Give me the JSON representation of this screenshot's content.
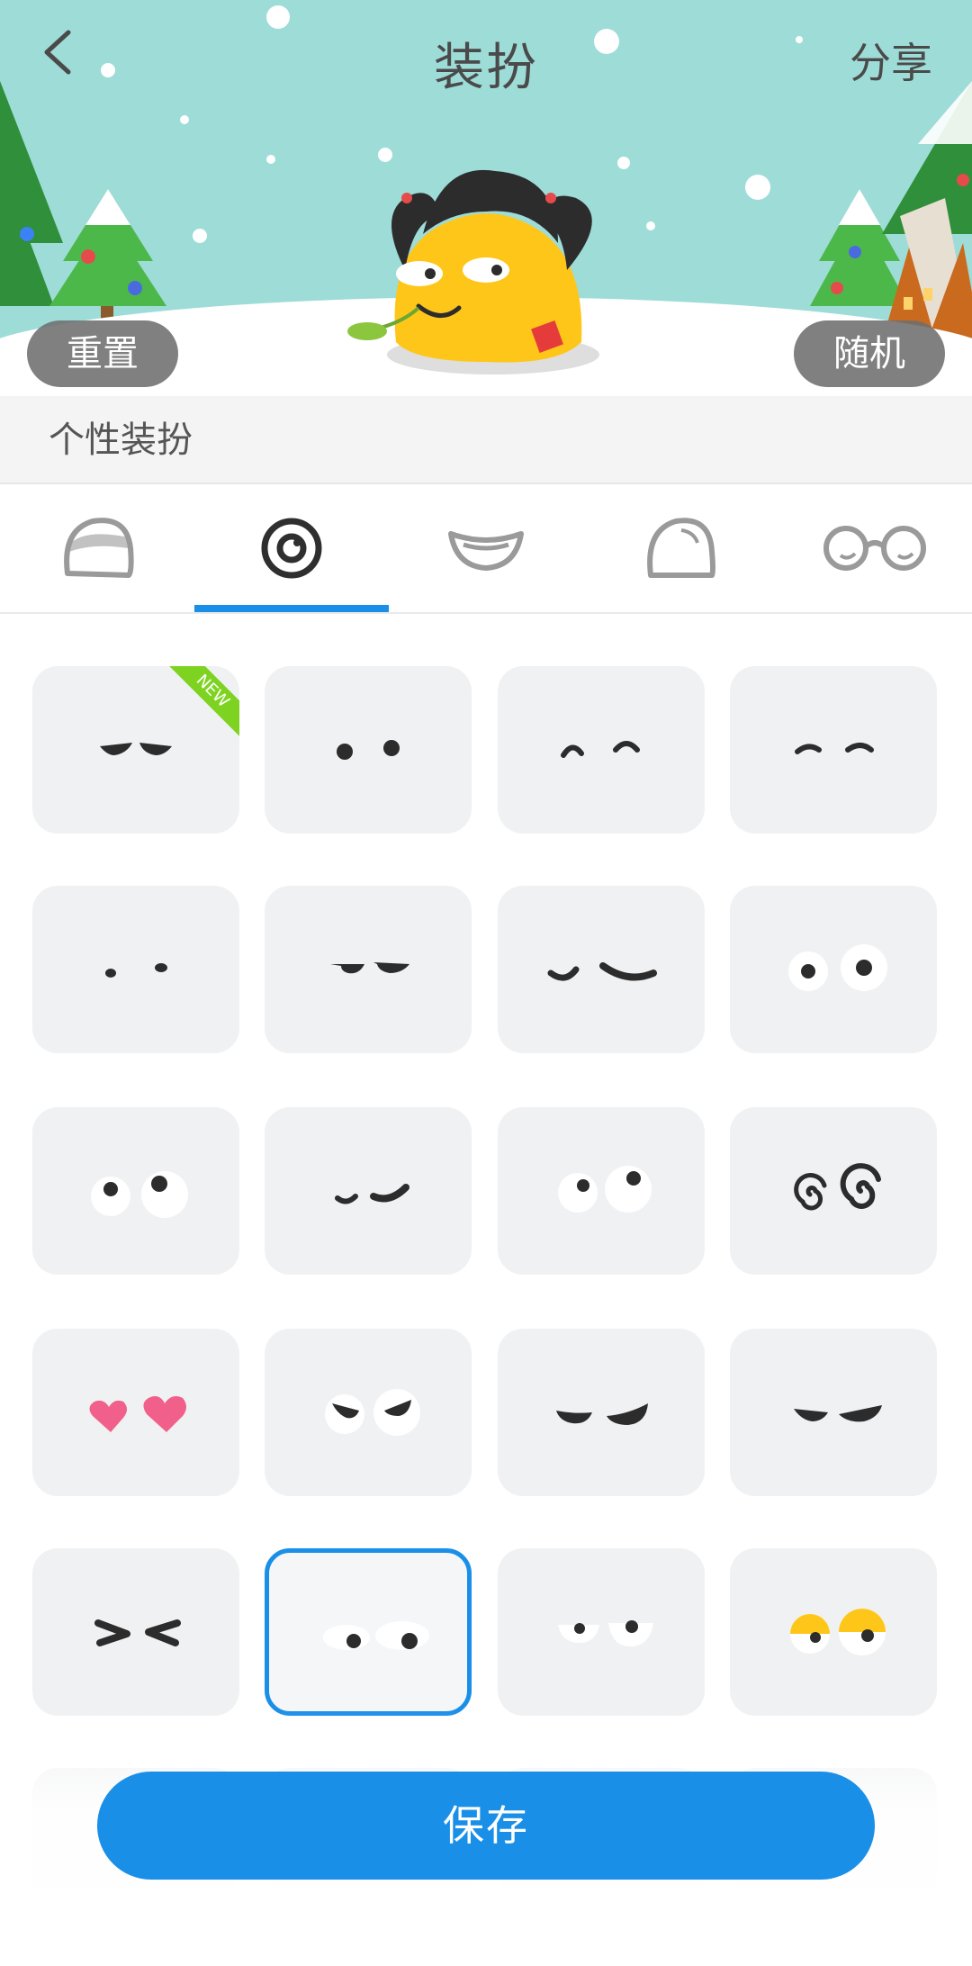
{
  "header": {
    "title": "装扮",
    "share_label": "分享",
    "reset_label": "重置",
    "random_label": "随机"
  },
  "section": {
    "label": "个性装扮"
  },
  "tabs": [
    {
      "name": "head-shape-icon",
      "active": false
    },
    {
      "name": "eyes-icon",
      "active": true
    },
    {
      "name": "mouth-icon",
      "active": false
    },
    {
      "name": "body-shape-icon",
      "active": false
    },
    {
      "name": "glasses-icon",
      "active": false
    }
  ],
  "grid": {
    "badge_new": "NEW",
    "selected_index": 17,
    "items": [
      "eyes-angry-brows",
      "eyes-dots",
      "eyes-happy-arcs",
      "eyes-relaxed-arcs",
      "eyes-small-dots",
      "eyes-flat-bored",
      "eyes-sleepy-curves",
      "eyes-round-white",
      "eyes-looking-up",
      "eyes-wink-smile",
      "eyes-side-glance",
      "eyes-dizzy-spirals",
      "eyes-hearts",
      "eyes-suspicious",
      "eyes-half-closed",
      "eyes-annoyed",
      "eyes-squint",
      "eyes-looking-down",
      "eyes-sleepy-white",
      "eyes-yellow-lids"
    ]
  },
  "footer": {
    "save_label": "保存"
  },
  "colors": {
    "accent": "#1a8fe8",
    "sky": "#9edcd8",
    "new_badge": "#7ed321",
    "heart": "#f0608a"
  }
}
